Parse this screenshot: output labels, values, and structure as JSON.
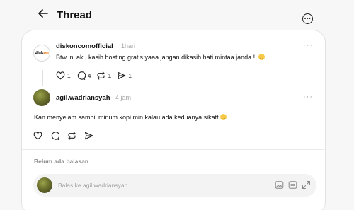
{
  "header": {
    "title": "Thread"
  },
  "post1": {
    "avatar_logo": {
      "prefix": "disk",
      "accent": "on"
    },
    "username": "diskoncomofficial",
    "time": "1hari",
    "text": "Btw ini aku kasih hosting gratis yaaa jangan dikasih hati mintaa janda !!",
    "stats": {
      "likes": "1",
      "comments": "4",
      "reposts": "1",
      "shares": "1"
    }
  },
  "post2": {
    "username": "agil.wadriansyah",
    "time": "4 jam",
    "text": "Kan menyelam sambil minum kopi min kalau ada keduanya sikatt"
  },
  "replies": {
    "empty_label": "Belum ada balasan"
  },
  "reply_box": {
    "placeholder": "Balas ke agil.wadriansyah..."
  },
  "icons": [
    "back-arrow-icon",
    "more-options-icon",
    "heart-icon",
    "comment-icon",
    "repost-icon",
    "share-icon",
    "image-icon",
    "gif-icon",
    "expand-icon"
  ],
  "colors": {
    "background": "#f7f7f8",
    "card": "#ffffff",
    "muted": "#a5a5a5",
    "logo_accent": "#e67d1a"
  }
}
